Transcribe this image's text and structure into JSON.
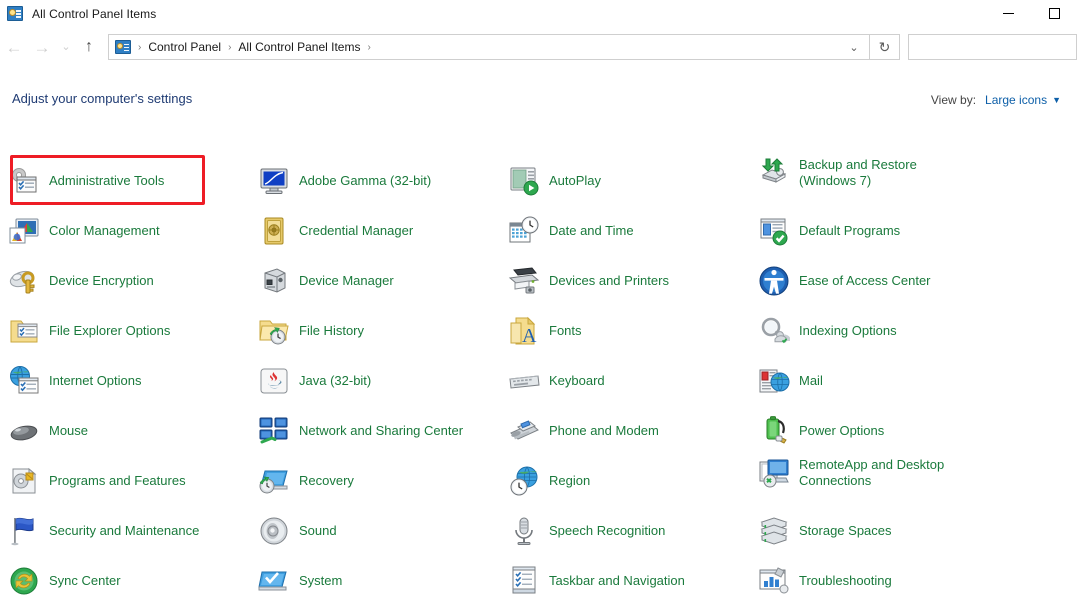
{
  "window": {
    "title": "All Control Panel Items",
    "title_icon": "control-panel-icon",
    "minimize_label": "—",
    "maximize_label": "☐"
  },
  "nav": {
    "back_glyph": "←",
    "forward_glyph": "→",
    "recent_glyph": "⌄",
    "up_glyph": "↑",
    "dropdown_glyph": "⌄",
    "refresh_glyph": "↻",
    "breadcrumb": [
      {
        "label": "Control Panel"
      },
      {
        "label": "All Control Panel Items"
      }
    ],
    "separator": "›",
    "search_value": "",
    "search_placeholder": ""
  },
  "header": {
    "subheading": "Adjust your computer's settings",
    "view_by_label": "View by:",
    "view_by_value": "Large icons",
    "view_by_caret": "▼"
  },
  "highlight": {
    "color": "#ee1c25",
    "target": "Administrative Tools"
  },
  "items": [
    {
      "label": "Administrative Tools",
      "icon": "administrative-tools-icon",
      "col": 0,
      "row": 0,
      "lines": 1
    },
    {
      "label": "Color Management",
      "icon": "color-management-icon",
      "col": 0,
      "row": 1,
      "lines": 1
    },
    {
      "label": "Device Encryption",
      "icon": "device-encryption-icon",
      "col": 0,
      "row": 2,
      "lines": 1
    },
    {
      "label": "File Explorer Options",
      "icon": "file-explorer-options-icon",
      "col": 0,
      "row": 3,
      "lines": 1
    },
    {
      "label": "Internet Options",
      "icon": "internet-options-icon",
      "col": 0,
      "row": 4,
      "lines": 1
    },
    {
      "label": "Mouse",
      "icon": "mouse-icon",
      "col": 0,
      "row": 5,
      "lines": 1
    },
    {
      "label": "Programs and Features",
      "icon": "programs-features-icon",
      "col": 0,
      "row": 6,
      "lines": 1
    },
    {
      "label": "Security and Maintenance",
      "icon": "security-maintenance-icon",
      "col": 0,
      "row": 7,
      "lines": 1
    },
    {
      "label": "Sync Center",
      "icon": "sync-center-icon",
      "col": 0,
      "row": 8,
      "lines": 1
    },
    {
      "label": "Adobe Gamma (32-bit)",
      "icon": "adobe-gamma-icon",
      "col": 1,
      "row": 0,
      "lines": 1
    },
    {
      "label": "Credential Manager",
      "icon": "credential-manager-icon",
      "col": 1,
      "row": 1,
      "lines": 1
    },
    {
      "label": "Device Manager",
      "icon": "device-manager-icon",
      "col": 1,
      "row": 2,
      "lines": 1
    },
    {
      "label": "File History",
      "icon": "file-history-icon",
      "col": 1,
      "row": 3,
      "lines": 1
    },
    {
      "label": "Java (32-bit)",
      "icon": "java-icon",
      "col": 1,
      "row": 4,
      "lines": 1
    },
    {
      "label": "Network and Sharing Center",
      "icon": "network-sharing-icon",
      "col": 1,
      "row": 5,
      "lines": 1
    },
    {
      "label": "Recovery",
      "icon": "recovery-icon",
      "col": 1,
      "row": 6,
      "lines": 1
    },
    {
      "label": "Sound",
      "icon": "sound-icon",
      "col": 1,
      "row": 7,
      "lines": 1
    },
    {
      "label": "System",
      "icon": "system-icon",
      "col": 1,
      "row": 8,
      "lines": 1
    },
    {
      "label": "AutoPlay",
      "icon": "autoplay-icon",
      "col": 2,
      "row": 0,
      "lines": 1
    },
    {
      "label": "Date and Time",
      "icon": "date-time-icon",
      "col": 2,
      "row": 1,
      "lines": 1
    },
    {
      "label": "Devices and Printers",
      "icon": "devices-printers-icon",
      "col": 2,
      "row": 2,
      "lines": 1
    },
    {
      "label": "Fonts",
      "icon": "fonts-icon",
      "col": 2,
      "row": 3,
      "lines": 1
    },
    {
      "label": "Keyboard",
      "icon": "keyboard-icon",
      "col": 2,
      "row": 4,
      "lines": 1
    },
    {
      "label": "Phone and Modem",
      "icon": "phone-modem-icon",
      "col": 2,
      "row": 5,
      "lines": 1
    },
    {
      "label": "Region",
      "icon": "region-icon",
      "col": 2,
      "row": 6,
      "lines": 1
    },
    {
      "label": "Speech Recognition",
      "icon": "speech-recognition-icon",
      "col": 2,
      "row": 7,
      "lines": 1
    },
    {
      "label": "Taskbar and Navigation",
      "icon": "taskbar-navigation-icon",
      "col": 2,
      "row": 8,
      "lines": 1
    },
    {
      "label": "Backup and Restore\n(Windows 7)",
      "icon": "backup-restore-icon",
      "col": 3,
      "row": 0,
      "lines": 2
    },
    {
      "label": "Default Programs",
      "icon": "default-programs-icon",
      "col": 3,
      "row": 1,
      "lines": 1
    },
    {
      "label": "Ease of Access Center",
      "icon": "ease-of-access-icon",
      "col": 3,
      "row": 2,
      "lines": 1
    },
    {
      "label": "Indexing Options",
      "icon": "indexing-options-icon",
      "col": 3,
      "row": 3,
      "lines": 1
    },
    {
      "label": "Mail",
      "icon": "mail-icon",
      "col": 3,
      "row": 4,
      "lines": 1
    },
    {
      "label": "Power Options",
      "icon": "power-options-icon",
      "col": 3,
      "row": 5,
      "lines": 1
    },
    {
      "label": "RemoteApp and Desktop\nConnections",
      "icon": "remoteapp-icon",
      "col": 3,
      "row": 6,
      "lines": 2
    },
    {
      "label": "Storage Spaces",
      "icon": "storage-spaces-icon",
      "col": 3,
      "row": 7,
      "lines": 1
    },
    {
      "label": "Troubleshooting",
      "icon": "troubleshooting-icon",
      "col": 3,
      "row": 8,
      "lines": 1
    }
  ]
}
